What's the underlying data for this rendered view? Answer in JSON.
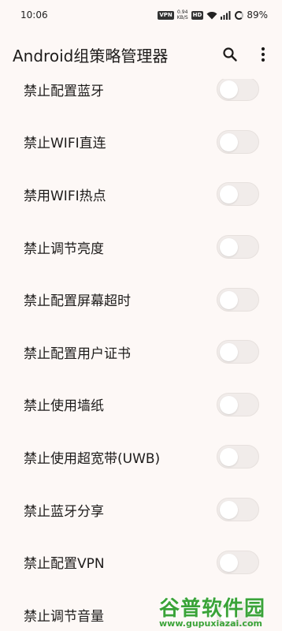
{
  "status_bar": {
    "time": "10:06",
    "vpn": "VPN",
    "net_speed_value": "0.94",
    "net_speed_unit": "KB/S",
    "hd": "HD",
    "battery": "89%"
  },
  "app_bar": {
    "title": "Android组策略管理器"
  },
  "settings": {
    "items": [
      {
        "label": "禁止配置蓝牙",
        "enabled": false
      },
      {
        "label": "禁止WIFI直连",
        "enabled": false
      },
      {
        "label": "禁用WIFI热点",
        "enabled": false
      },
      {
        "label": "禁止调节亮度",
        "enabled": false
      },
      {
        "label": "禁止配置屏幕超时",
        "enabled": false
      },
      {
        "label": "禁止配置用户证书",
        "enabled": false
      },
      {
        "label": "禁止使用墙纸",
        "enabled": false
      },
      {
        "label": "禁止使用超宽带(UWB)",
        "enabled": false
      },
      {
        "label": "禁止蓝牙分享",
        "enabled": false
      },
      {
        "label": "禁止配置VPN",
        "enabled": false
      },
      {
        "label": "禁止调节音量",
        "enabled": false
      }
    ]
  },
  "watermark": {
    "name": "谷普软件园",
    "url": "www.gupuxiazai.com"
  },
  "colors": {
    "background": "#fdf8f6",
    "watermark_green": "#3aa338",
    "switch_track_off": "#f1ecea"
  }
}
